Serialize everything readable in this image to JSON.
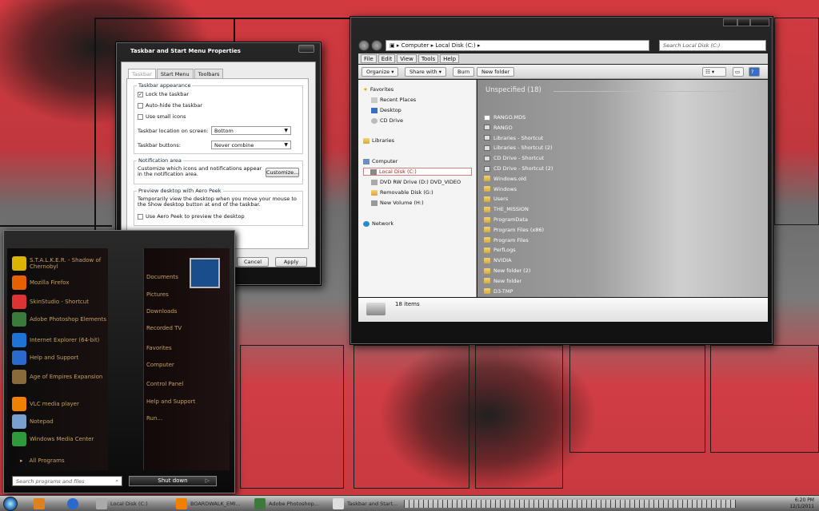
{
  "taskbar_props": {
    "title": "Taskbar and Start Menu Properties",
    "tabs": [
      "Taskbar",
      "Start Menu",
      "Toolbars"
    ],
    "appearance_title": "Taskbar appearance",
    "lock": "Lock the taskbar",
    "autohide": "Auto-hide the taskbar",
    "small_icons": "Use small icons",
    "location_label": "Taskbar location on screen:",
    "location_value": "Bottom",
    "buttons_label": "Taskbar buttons:",
    "buttons_value": "Never combine",
    "notification_title": "Notification area",
    "notification_text": "Customize which icons and notifications appear in the notification area.",
    "customize": "Customize...",
    "peek_title": "Preview desktop with Aero Peek",
    "peek_text": "Temporarily view the desktop when you move your mouse to the Show desktop button at end of the taskbar.",
    "peek_cb": "Use Aero Peek to preview the desktop",
    "cancel": "Cancel",
    "apply": "Apply"
  },
  "explorer": {
    "address": [
      "Computer",
      "Local Disk (C:)"
    ],
    "search_placeholder": "Search Local Disk (C:)",
    "menu": [
      "File",
      "Edit",
      "View",
      "Tools",
      "Help"
    ],
    "commands": [
      "Organize",
      "Share with",
      "Burn",
      "New folder"
    ],
    "nav": {
      "favorites": "Favorites",
      "recent": "Recent Places",
      "desktop": "Desktop",
      "cd": "CD Drive",
      "libraries": "Libraries",
      "computer": "Computer",
      "local": "Local Disk (C:)",
      "dvd": "DVD RW Drive (D:) DVD_VIDEO",
      "removable": "Removable Disk (G:)",
      "newvol": "New Volume (H:)",
      "network": "Network"
    },
    "group_header": "Unspecified (18)",
    "files": [
      {
        "name": "RANGO.MDS",
        "kind": "doc"
      },
      {
        "name": "RANGO",
        "kind": "shortcut"
      },
      {
        "name": "Libraries - Shortcut",
        "kind": "shortcut"
      },
      {
        "name": "Libraries - Shortcut (2)",
        "kind": "shortcut"
      },
      {
        "name": "CD Drive - Shortcut",
        "kind": "shortcut"
      },
      {
        "name": "CD Drive - Shortcut (2)",
        "kind": "shortcut"
      },
      {
        "name": "Windows.old",
        "kind": "folder"
      },
      {
        "name": "Windows",
        "kind": "folder"
      },
      {
        "name": "Users",
        "kind": "folder"
      },
      {
        "name": "THE_MISSION",
        "kind": "folder"
      },
      {
        "name": "ProgramData",
        "kind": "folder"
      },
      {
        "name": "Program Files (x86)",
        "kind": "folder"
      },
      {
        "name": "Program Files",
        "kind": "folder"
      },
      {
        "name": "PerfLogs",
        "kind": "folder"
      },
      {
        "name": "NVIDIA",
        "kind": "folder"
      },
      {
        "name": "New folder (2)",
        "kind": "folder"
      },
      {
        "name": "New folder",
        "kind": "folder"
      },
      {
        "name": "D3-TMP",
        "kind": "folder"
      }
    ],
    "status": "18 items"
  },
  "start_menu": {
    "programs": [
      {
        "label": "S.T.A.L.K.E.R. - Shadow of Chernobyl",
        "color": "#d9b400"
      },
      {
        "label": "Mozilla Firefox",
        "color": "#e66000"
      },
      {
        "label": "SkinStudio - Shortcut",
        "color": "#d33"
      },
      {
        "label": "Adobe Photoshop Elements",
        "color": "#3a7a3a"
      },
      {
        "label": "Internet Explorer (64-bit)",
        "color": "#1e73d6"
      },
      {
        "label": "Help and Support",
        "color": "#2a6acc"
      },
      {
        "label": "Age of Empires Expansion",
        "color": "#8a6a3a"
      },
      {
        "label": "VLC media player",
        "color": "#f08000"
      },
      {
        "label": "Notepad",
        "color": "#7aa0d0"
      },
      {
        "label": "Windows Media Center",
        "color": "#2f9a3a"
      }
    ],
    "all_programs": "All Programs",
    "places": [
      "Documents",
      "Pictures",
      "Downloads",
      "Recorded TV",
      "Favorites",
      "Computer",
      "Control Panel",
      "Help and Support",
      "Run..."
    ],
    "search_placeholder": "Search programs and files",
    "shutdown": "Shut down"
  },
  "taskbar": {
    "buttons": [
      "Local Disk (C:)",
      "BOARDWALK_EMI...",
      "Adobe Photoshop...",
      "Taskbar and Start..."
    ],
    "time": "6:20 PM",
    "date": "12/1/2011"
  }
}
